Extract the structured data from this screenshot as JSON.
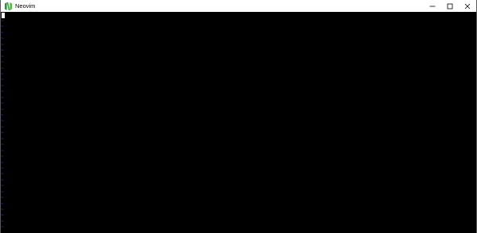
{
  "window": {
    "title": "Neovim",
    "icon": "neovim-logo-icon",
    "controls": {
      "minimize": "minimize-icon",
      "maximize": "maximize-icon",
      "close": "close-icon"
    }
  },
  "editor": {
    "empty_line_marker": "~",
    "colors": {
      "background": "#000000",
      "tilde": "#3b3bff",
      "cursor": "#ffffff"
    }
  }
}
